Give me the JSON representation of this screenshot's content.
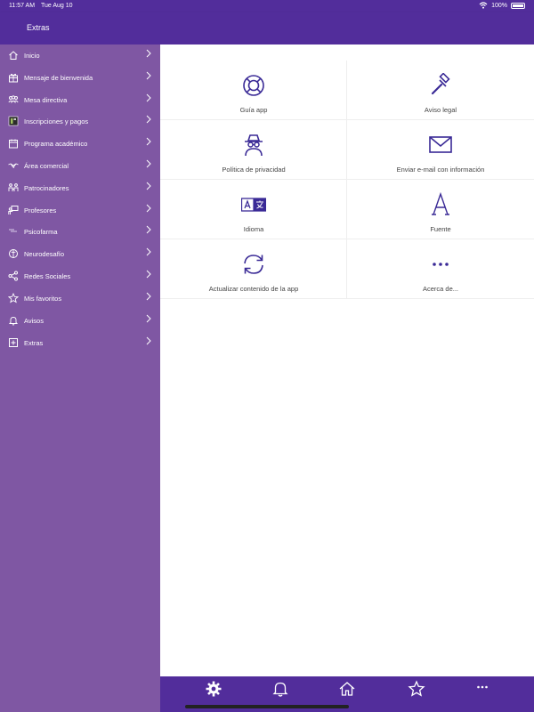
{
  "status_bar": {
    "time": "11:57 AM",
    "date": "Tue Aug 10",
    "battery": "100%"
  },
  "nav": {
    "title": "Extras"
  },
  "sidebar": {
    "items": [
      {
        "label": "Inicio",
        "icon": "home-icon"
      },
      {
        "label": "Mensaje de bienvenida",
        "icon": "gift-icon"
      },
      {
        "label": "Mesa directiva",
        "icon": "people-icon"
      },
      {
        "label": "Inscripciones y pagos",
        "icon": "ticket-icon"
      },
      {
        "label": "Programa académico",
        "icon": "calendar-icon"
      },
      {
        "label": "Área comercial",
        "icon": "handshake-icon"
      },
      {
        "label": "Patrocinadores",
        "icon": "sponsors-icon"
      },
      {
        "label": "Profesores",
        "icon": "teacher-icon"
      },
      {
        "label": "Psicofarma",
        "icon": "pill-icon"
      },
      {
        "label": "Neurodesafío",
        "icon": "puzzle-icon"
      },
      {
        "label": "Redes Sociales",
        "icon": "share-icon"
      },
      {
        "label": "Mis favoritos",
        "icon": "star-icon"
      },
      {
        "label": "Avisos",
        "icon": "bell-icon"
      },
      {
        "label": "Extras",
        "icon": "plus-box-icon"
      }
    ]
  },
  "extras": {
    "items": [
      {
        "label": "Guía app",
        "icon": "lifebuoy-icon"
      },
      {
        "label": "Aviso legal",
        "icon": "gavel-icon"
      },
      {
        "label": "Política de privacidad",
        "icon": "spy-icon"
      },
      {
        "label": "Enviar e-mail con información",
        "icon": "envelope-icon"
      },
      {
        "label": "Idioma",
        "icon": "translate-icon"
      },
      {
        "label": "Fuente",
        "icon": "font-icon"
      },
      {
        "label": "Actualizar contenido de la app",
        "icon": "refresh-icon"
      },
      {
        "label": "Acerca de...",
        "icon": "ellipsis-icon"
      }
    ]
  },
  "tab_bar": {
    "tabs": [
      "gear-icon",
      "bell-icon",
      "home-icon",
      "star-icon",
      "ellipsis-icon"
    ]
  },
  "colors": {
    "brand": "#522d9b",
    "sidebar": "#7f57a3",
    "icon": "#3a2a96"
  }
}
